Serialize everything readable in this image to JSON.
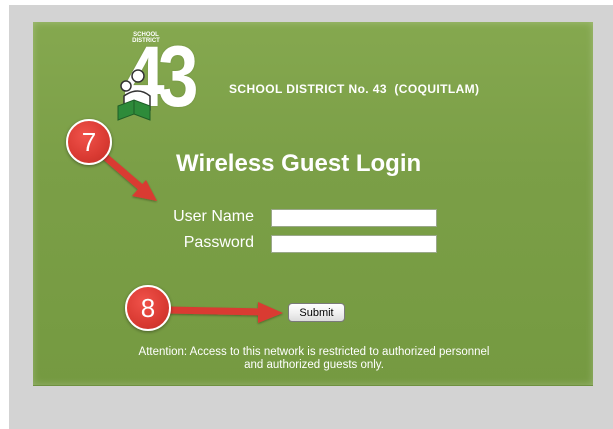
{
  "header": {
    "district_name": "SCHOOL DISTRICT No. 43  (COQUITLAM)",
    "logo_number": "43",
    "logo_arc_text": "SCHOOL DISTRICT"
  },
  "form": {
    "title": "Wireless Guest Login",
    "username_label": "User Name",
    "username_value": "",
    "password_label": "Password",
    "password_value": "",
    "submit_label": "Submit"
  },
  "notice": {
    "line1": "Attention: Access to this network is restricted to authorized personnel",
    "line2": "and authorized guests only."
  },
  "annotations": {
    "step_7": "7",
    "step_8": "8",
    "color": "#d93a32"
  },
  "colors": {
    "panel": "#7b9f47",
    "frame": "#d3d3d3"
  }
}
